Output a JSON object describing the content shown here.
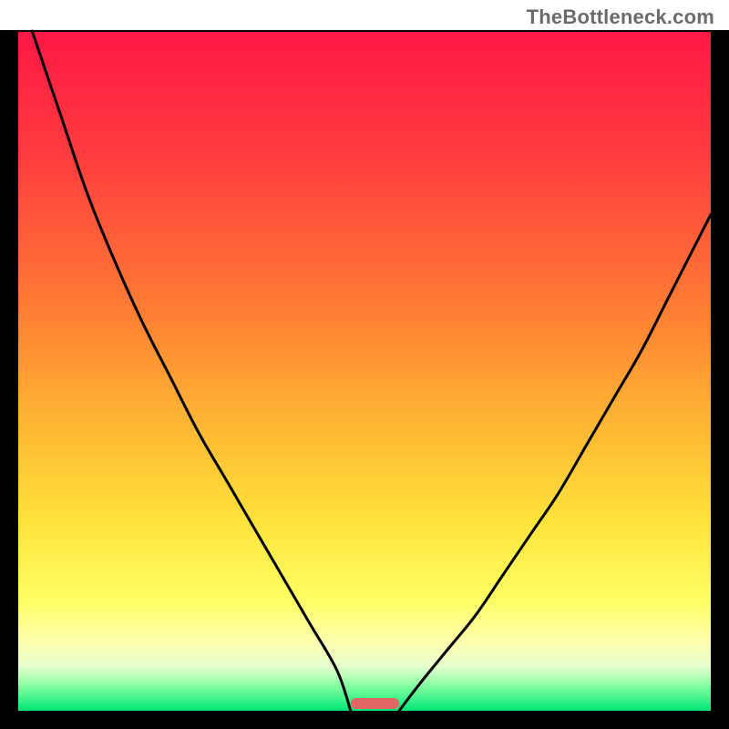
{
  "watermark": "TheBottleneck.com",
  "chart_data": {
    "type": "line",
    "title": "",
    "xlabel": "",
    "ylabel": "",
    "xlim": [
      0,
      100
    ],
    "ylim": [
      0,
      100
    ],
    "grid": false,
    "legend": false,
    "background_gradient_stops": [
      {
        "offset": 0.0,
        "color": "#ff1744"
      },
      {
        "offset": 0.18,
        "color": "#ff3b3f"
      },
      {
        "offset": 0.4,
        "color": "#ff7a33"
      },
      {
        "offset": 0.58,
        "color": "#ffb733"
      },
      {
        "offset": 0.72,
        "color": "#ffe23a"
      },
      {
        "offset": 0.84,
        "color": "#ffff66"
      },
      {
        "offset": 0.9,
        "color": "#ffffb0"
      },
      {
        "offset": 0.935,
        "color": "#e6ffcc"
      },
      {
        "offset": 0.965,
        "color": "#80ff9f"
      },
      {
        "offset": 1.0,
        "color": "#00e676"
      }
    ],
    "series": [
      {
        "name": "left-branch",
        "x": [
          2,
          6,
          10,
          14,
          18,
          22,
          26,
          30,
          34,
          38,
          42,
          46,
          48
        ],
        "y": [
          100,
          88,
          76,
          66,
          57,
          49,
          41,
          34,
          27,
          20,
          13,
          6,
          0
        ]
      },
      {
        "name": "right-branch",
        "x": [
          55,
          58,
          62,
          66,
          70,
          74,
          78,
          82,
          86,
          90,
          94,
          98,
          100
        ],
        "y": [
          0,
          4,
          9,
          14,
          20,
          26,
          32,
          39,
          46,
          53,
          61,
          69,
          73
        ]
      }
    ],
    "marker": {
      "x_center": 51.5,
      "width": 7,
      "color": "#e06666"
    },
    "frame_color": "#000000",
    "curve_color": "#000000"
  }
}
